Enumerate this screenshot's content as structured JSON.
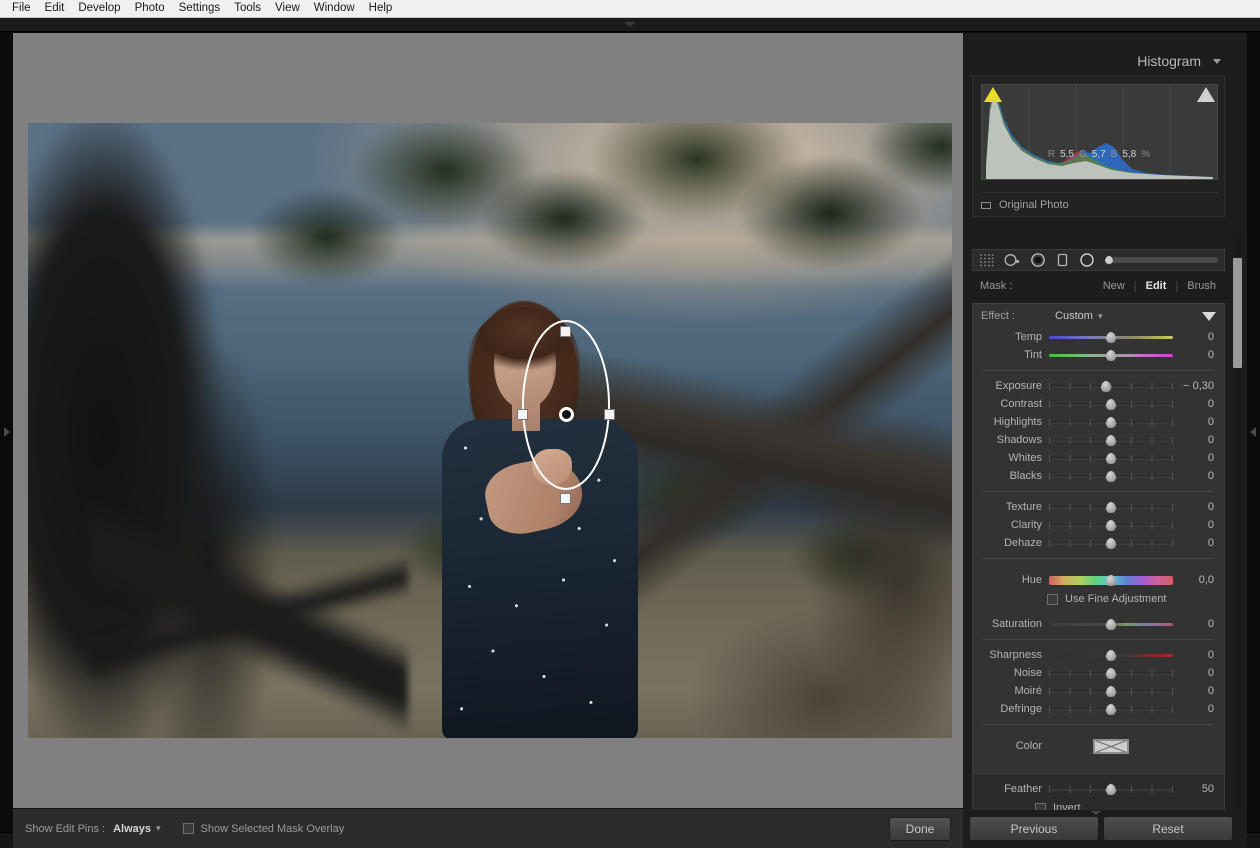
{
  "menubar": {
    "items": [
      {
        "label": "File"
      },
      {
        "label": "Edit"
      },
      {
        "label": "Develop"
      },
      {
        "label": "Photo"
      },
      {
        "label": "Settings"
      },
      {
        "label": "Tools"
      },
      {
        "label": "View"
      },
      {
        "label": "Window"
      },
      {
        "label": "Help"
      }
    ]
  },
  "panel": {
    "header_title": "Histogram",
    "collapse_icon": "chevron-down-icon"
  },
  "histogram": {
    "r_label": "R",
    "r_value": "5,5",
    "g_label": "G",
    "g_value": "5,7",
    "b_label": "B",
    "b_value": "5,8",
    "unit": "%",
    "original_photo_label": "Original Photo",
    "shadow_clip_color": "#e8dc2a",
    "highlight_clip_color": "#cfcfcf"
  },
  "mask_tools": {
    "icons": [
      "select-subject-icon",
      "brush-icon",
      "radial-filter-active-icon",
      "linear-gradient-icon",
      "radial-gradient-icon"
    ],
    "size_slider_value": 0
  },
  "mask_row": {
    "label": "Mask :",
    "actions": [
      {
        "label": "New",
        "active": false
      },
      {
        "label": "Edit",
        "active": true
      },
      {
        "label": "Brush",
        "active": false
      }
    ]
  },
  "effect": {
    "label": "Effect :",
    "value": "Custom",
    "stepper_icon": "stepper-icon",
    "caret_icon": "caret-down-icon"
  },
  "sliders": {
    "group_wb": [
      {
        "name": "Temp",
        "value": "0",
        "pos": 50,
        "track": "temp"
      },
      {
        "name": "Tint",
        "value": "0",
        "pos": 50,
        "track": "tint"
      }
    ],
    "group_tone": [
      {
        "name": "Exposure",
        "value": "− 0,30",
        "pos": 46,
        "track": "plain"
      },
      {
        "name": "Contrast",
        "value": "0",
        "pos": 50,
        "track": "plain"
      },
      {
        "name": "Highlights",
        "value": "0",
        "pos": 50,
        "track": "plain"
      },
      {
        "name": "Shadows",
        "value": "0",
        "pos": 50,
        "track": "plain"
      },
      {
        "name": "Whites",
        "value": "0",
        "pos": 50,
        "track": "plain"
      },
      {
        "name": "Blacks",
        "value": "0",
        "pos": 50,
        "track": "plain"
      }
    ],
    "group_presence": [
      {
        "name": "Texture",
        "value": "0",
        "pos": 50,
        "track": "plain"
      },
      {
        "name": "Clarity",
        "value": "0",
        "pos": 50,
        "track": "plain"
      },
      {
        "name": "Dehaze",
        "value": "0",
        "pos": 50,
        "track": "plain"
      }
    ],
    "group_hue": [
      {
        "name": "Hue",
        "value": "0,0",
        "pos": 50,
        "track": "hue"
      }
    ],
    "fine_adjust_label": "Use Fine Adjustment",
    "group_sat": [
      {
        "name": "Saturation",
        "value": "0",
        "pos": 50,
        "track": "sat"
      }
    ],
    "group_detail": [
      {
        "name": "Sharpness",
        "value": "0",
        "pos": 50,
        "track": "sharp"
      },
      {
        "name": "Noise",
        "value": "0",
        "pos": 50,
        "track": "plain"
      },
      {
        "name": "Moiré",
        "value": "0",
        "pos": 50,
        "track": "plain"
      },
      {
        "name": "Defringe",
        "value": "0",
        "pos": 50,
        "track": "plain"
      }
    ],
    "color_label": "Color",
    "feather": {
      "name": "Feather",
      "value": "50",
      "pos": 50
    },
    "invert_label": "Invert"
  },
  "toolbar": {
    "show_edit_pins_label": "Show Edit Pins :",
    "show_edit_pins_value": "Always",
    "mask_overlay_label": "Show Selected Mask Overlay",
    "done_label": "Done"
  },
  "panel_buttons": {
    "previous_label": "Previous",
    "reset_label": "Reset"
  },
  "mask_overlay": {
    "shape": "radial-gradient-ellipse",
    "handles": [
      "top",
      "left",
      "right",
      "bottom"
    ],
    "pin": "mask-center-pin"
  },
  "colors": {
    "panel_bg": "#1d1d1d",
    "section_bg": "#333333",
    "canvas_bg": "#808080",
    "accent_text": "#e4e4e4"
  }
}
